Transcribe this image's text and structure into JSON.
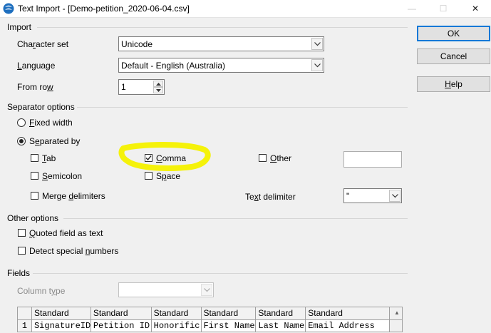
{
  "window": {
    "title": "Text Import - [Demo-petition_2020-06-04.csv]",
    "controls": {
      "minimize": "—",
      "maximize": "☐",
      "close": "✕"
    }
  },
  "import": {
    "section_label": "Import",
    "character_set": {
      "label_pre": "Cha",
      "label_u": "r",
      "label_post": "acter set",
      "value": "Unicode"
    },
    "language": {
      "label_u": "L",
      "label_post": "anguage",
      "value": "Default - English (Australia)"
    },
    "from_row": {
      "label_pre": "From ro",
      "label_u": "w",
      "value": "1"
    }
  },
  "separator_options": {
    "section_label": "Separator options",
    "fixed_width": {
      "label_u": "F",
      "label_post": "ixed width",
      "selected": false
    },
    "separated_by": {
      "label_pre": "S",
      "label_u": "e",
      "label_post": "parated by",
      "selected": true
    },
    "tab": {
      "label_u": "T",
      "label_post": "ab",
      "checked": false
    },
    "comma": {
      "label_u": "C",
      "label_post": "omma",
      "checked": true
    },
    "other": {
      "label_u": "O",
      "label_post": "ther",
      "checked": false,
      "value": ""
    },
    "semicolon": {
      "label_u": "S",
      "label_post": "emicolon",
      "checked": false
    },
    "space": {
      "label_pre": "S",
      "label_u": "p",
      "label_post": "ace",
      "checked": false
    },
    "merge_delimiters": {
      "label_pre": "Merge ",
      "label_u": "d",
      "label_post": "elimiters",
      "checked": false
    },
    "text_delimiter": {
      "label_pre": "Te",
      "label_u": "x",
      "label_post": "t delimiter",
      "value": "\""
    }
  },
  "other_options": {
    "section_label": "Other options",
    "quoted_field": {
      "label_u": "Q",
      "label_post": "uoted field as text",
      "checked": false
    },
    "detect_special": {
      "label_pre": "Detect special ",
      "label_u": "n",
      "label_post": "umbers",
      "checked": false
    }
  },
  "fields": {
    "section_label": "Fields",
    "column_type": {
      "label_pre": "Column t",
      "label_u": "y",
      "label_post": "pe",
      "value": ""
    },
    "headers": [
      "Standard",
      "Standard",
      "Standard",
      "Standard",
      "Standard",
      "Standard"
    ],
    "rows": [
      {
        "num": "1",
        "cells": [
          "SignatureID",
          "Petition ID",
          "Honorific",
          "First Name",
          "Last Name",
          "Email Address"
        ]
      }
    ]
  },
  "buttons": {
    "ok": "OK",
    "cancel": "Cancel",
    "help_u": "H",
    "help_post": "elp"
  },
  "annotation": {
    "color": "#f5f20a"
  },
  "colors": {
    "accent": "#0078d7",
    "background": "#f0f0f0"
  }
}
